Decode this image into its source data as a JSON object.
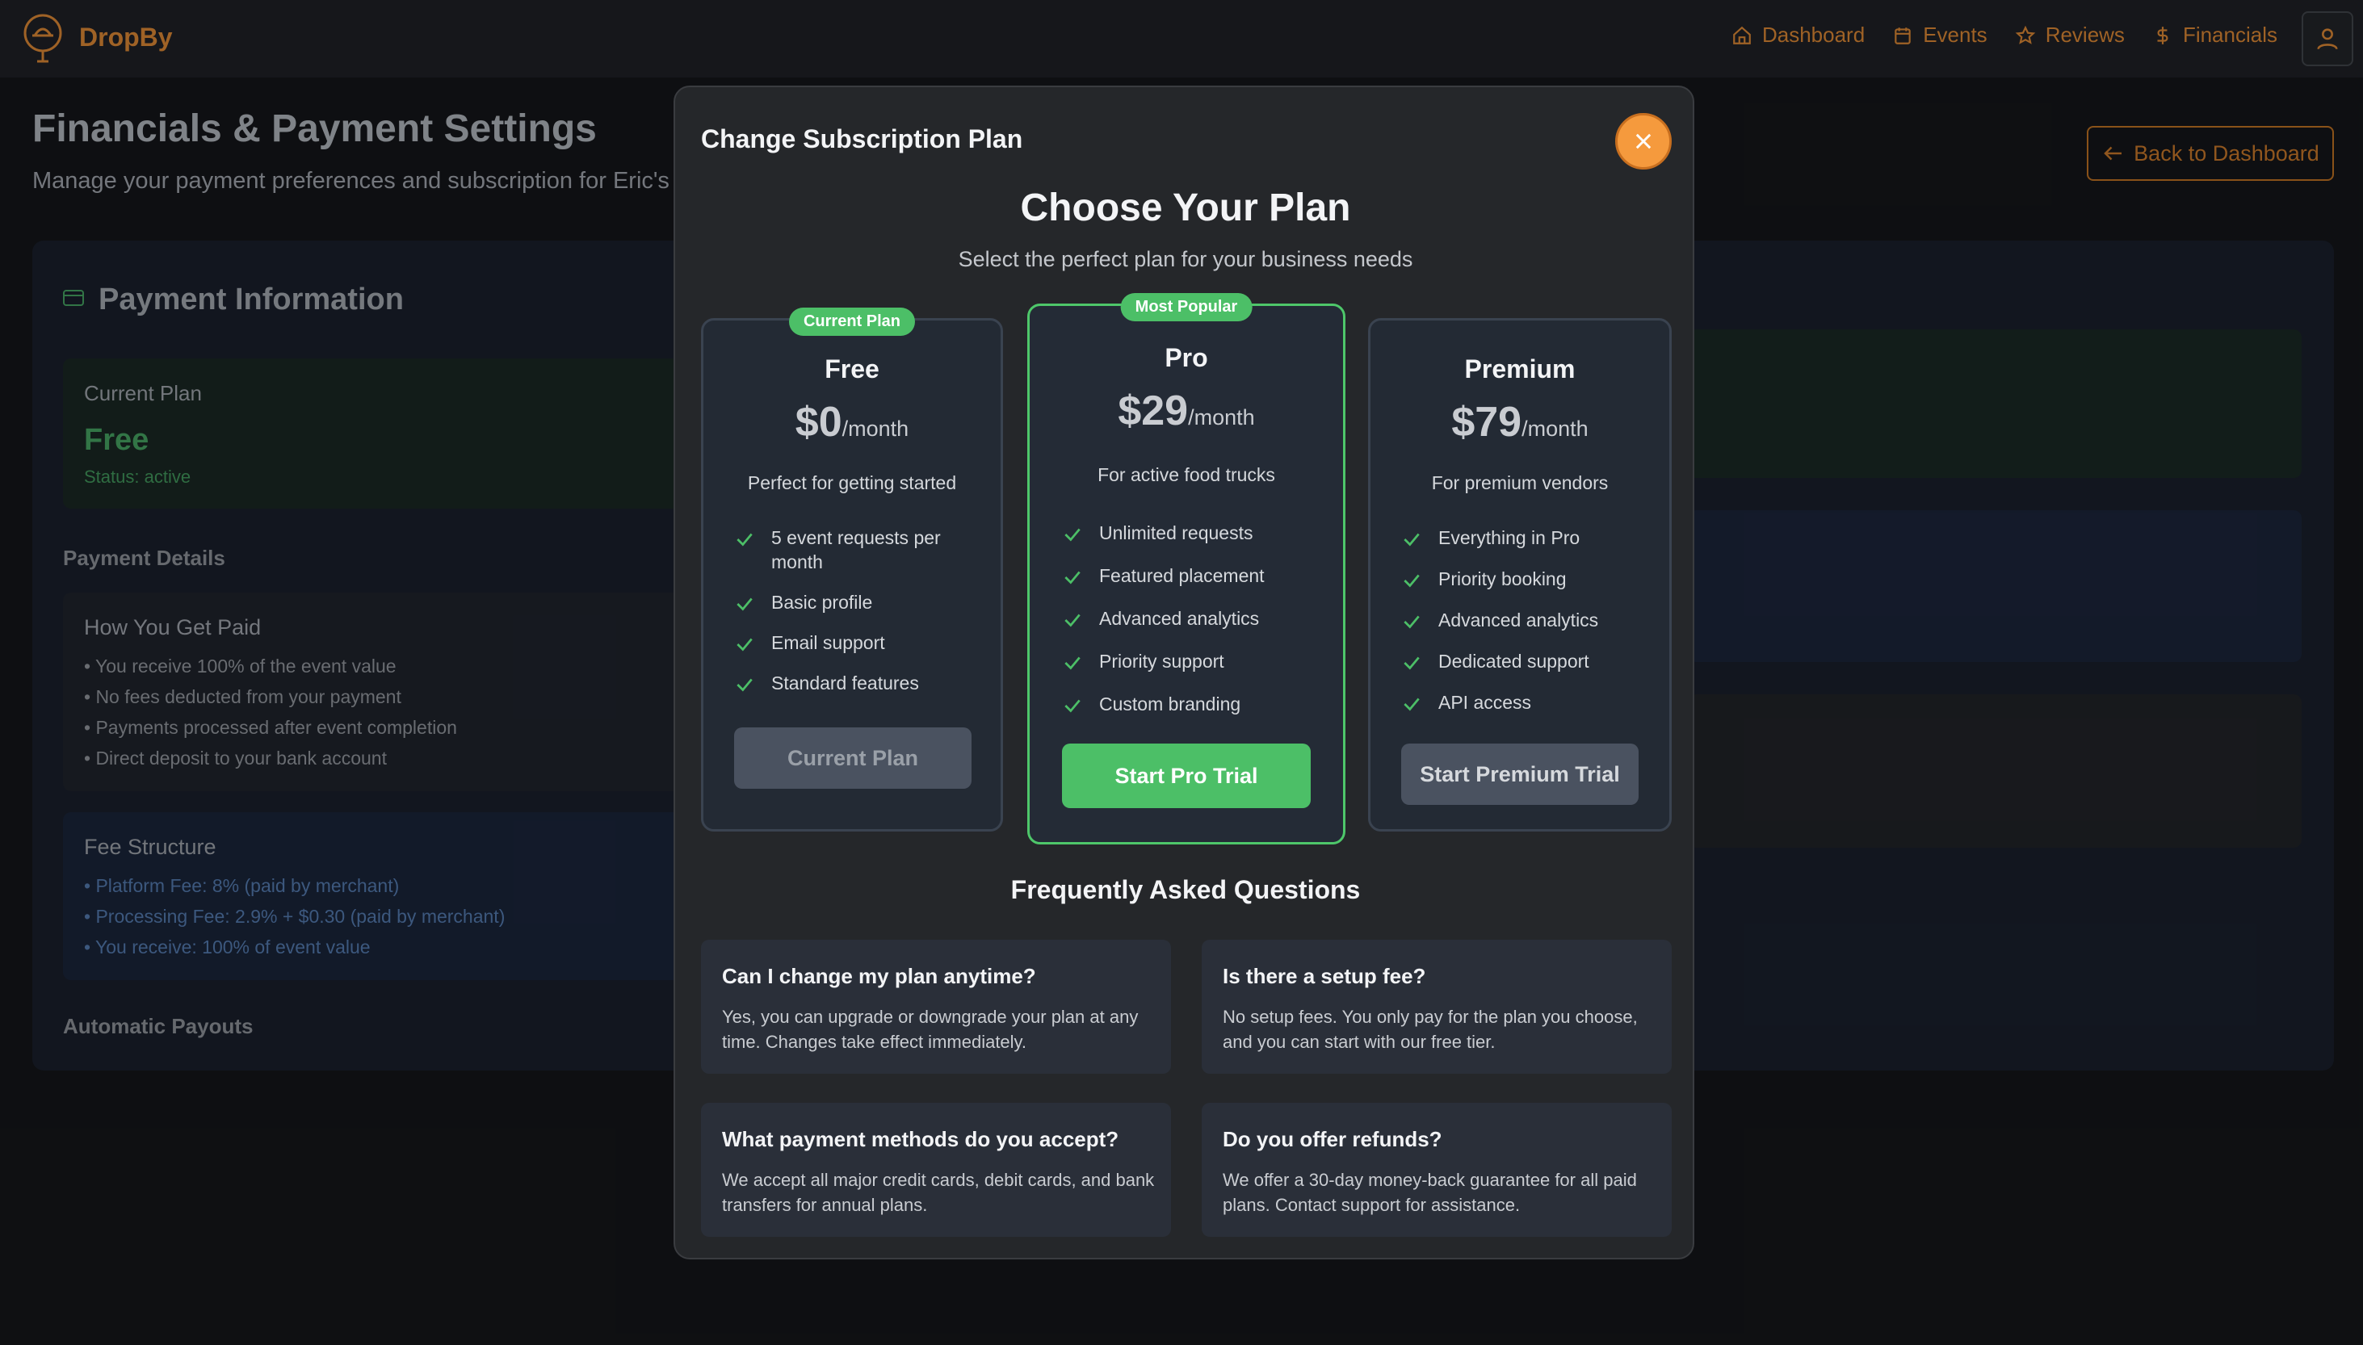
{
  "app": {
    "brand": "DropBy"
  },
  "nav": {
    "items": [
      {
        "label": "Dashboard",
        "icon": "home-icon"
      },
      {
        "label": "Events",
        "icon": "calendar-icon"
      },
      {
        "label": "Reviews",
        "icon": "star-icon"
      },
      {
        "label": "Financials",
        "icon": "dollar-icon"
      }
    ],
    "user_icon": "user-icon"
  },
  "page": {
    "title": "Financials & Payment Settings",
    "subtitle": "Manage your payment preferences and subscription for Eric's",
    "back_button": "Back to Dashboard"
  },
  "payment_info": {
    "title": "Payment Information",
    "current_plan_label": "Current Plan",
    "current_plan_name": "Free",
    "status": "Status: active",
    "payment_details_label": "Payment Details",
    "how_paid": {
      "title": "How You Get Paid",
      "items": [
        "• You receive 100% of the event value",
        "• No fees deducted from your payment",
        "• Payments processed after event completion",
        "• Direct deposit to your bank account"
      ]
    },
    "fee_structure": {
      "title": "Fee Structure",
      "items": [
        "• Platform Fee: 8% (paid by merchant)",
        "• Processing Fee: 2.9% + $0.30 (paid by merchant)",
        "• You receive: 100% of event value"
      ]
    },
    "automatic_payouts_label": "Automatic Payouts"
  },
  "modal": {
    "title": "Change Subscription Plan",
    "heading": "Choose Your Plan",
    "subheading": "Select the perfect plan for your business needs",
    "plans": {
      "free": {
        "badge": "Current Plan",
        "name": "Free",
        "price": "$0",
        "period": "/month",
        "description": "Perfect for getting started",
        "features": [
          "5 event requests per month",
          "Basic profile",
          "Email support",
          "Standard features"
        ],
        "button": "Current Plan"
      },
      "pro": {
        "badge": "Most Popular",
        "name": "Pro",
        "price": "$29",
        "period": "/month",
        "description": "For active food trucks",
        "features": [
          "Unlimited requests",
          "Featured placement",
          "Advanced analytics",
          "Priority support",
          "Custom branding"
        ],
        "button": "Start Pro Trial"
      },
      "premium": {
        "name": "Premium",
        "price": "$79",
        "period": "/month",
        "description": "For premium vendors",
        "features": [
          "Everything in Pro",
          "Priority booking",
          "Advanced analytics",
          "Dedicated support",
          "API access"
        ],
        "button": "Start Premium Trial"
      }
    },
    "faq": {
      "title": "Frequently Asked Questions",
      "items": [
        {
          "q": "Can I change my plan anytime?",
          "a": "Yes, you can upgrade or downgrade your plan at any time. Changes take effect immediately."
        },
        {
          "q": "Is there a setup fee?",
          "a": "No setup fees. You only pay for the plan you choose, and you can start with our free tier."
        },
        {
          "q": "What payment methods do you accept?",
          "a": "We accept all major credit cards, debit cards, and bank transfers for annual plans."
        },
        {
          "q": "Do you offer refunds?",
          "a": "We offer a 30-day money-back guarantee for all paid plans. Contact support for assistance."
        }
      ]
    }
  },
  "colors": {
    "accent": "#c2782f",
    "success": "#4cbf67",
    "close": "#f59a3d"
  }
}
